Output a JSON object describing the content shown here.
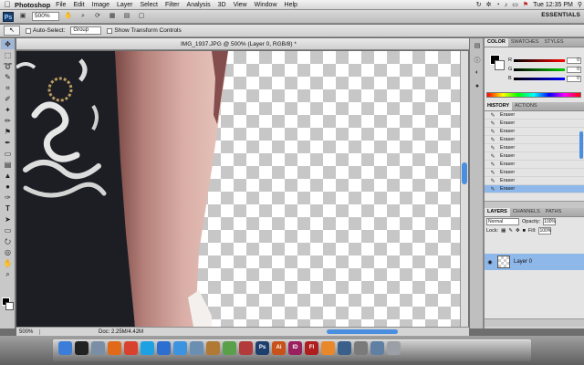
{
  "colors": {
    "accent": "#4a8ee0",
    "selection": "#8fb8ea",
    "ps_brand": "#1c3f6e"
  },
  "menubar": {
    "apple_icon": "apple-icon",
    "app_name": "Photoshop",
    "items": [
      "File",
      "Edit",
      "Image",
      "Layer",
      "Select",
      "Filter",
      "Analysis",
      "3D",
      "View",
      "Window",
      "Help"
    ],
    "time": "Tue 12:35 PM"
  },
  "appbar": {
    "logo": "Ps",
    "zoom": "500%",
    "workspace": "ESSENTIALS"
  },
  "options": {
    "auto_select": "Auto-Select:",
    "auto_select_target": "Group",
    "transform_controls": "Show Transform Controls"
  },
  "document": {
    "tab_title": "IMG_1937.JPG @ 500% (Layer 0, RGB/8) *",
    "status_zoom": "500%",
    "status_info": "Doc: 2.25M/4.42M"
  },
  "color_panel": {
    "tabs": [
      "COLOR",
      "SWATCHES",
      "STYLES"
    ],
    "r": "0",
    "g": "0",
    "b": "0"
  },
  "history_panel": {
    "tabs": [
      "HISTORY",
      "ACTIONS"
    ],
    "items": [
      "Eraser",
      "Eraser",
      "Eraser",
      "Eraser",
      "Eraser",
      "Eraser",
      "Eraser",
      "Eraser",
      "Eraser",
      "Eraser"
    ]
  },
  "layers_panel": {
    "tabs": [
      "LAYERS",
      "CHANNELS",
      "PATHS"
    ],
    "blend_mode": "Normal",
    "opacity_label": "Opacity:",
    "opacity": "100%",
    "lock_label": "Lock:",
    "fill_label": "Fill:",
    "fill": "100%",
    "layer_name": "Layer 0"
  },
  "dock": {
    "apps": [
      {
        "name": "finder-icon",
        "label": "",
        "color": "#3b7dd8"
      },
      {
        "name": "dashboard-icon",
        "label": "",
        "color": "#222"
      },
      {
        "name": "mail-icon",
        "label": "",
        "color": "#7a8ea6"
      },
      {
        "name": "firefox-icon",
        "label": "",
        "color": "#e06a1a"
      },
      {
        "name": "chrome-icon",
        "label": "",
        "color": "#d9412f"
      },
      {
        "name": "skype-icon",
        "label": "",
        "color": "#1da1e2"
      },
      {
        "name": "itunes-icon",
        "label": "",
        "color": "#2d6fd1"
      },
      {
        "name": "safari-icon",
        "label": "",
        "color": "#3c93e0"
      },
      {
        "name": "preview-icon",
        "label": "",
        "color": "#6b8fb3"
      },
      {
        "name": "tools-icon",
        "label": "",
        "color": "#b07a34"
      },
      {
        "name": "facetime-icon",
        "label": "",
        "color": "#5aa04a"
      },
      {
        "name": "photobooth-icon",
        "label": "",
        "color": "#b33a3a"
      },
      {
        "name": "photoshop-icon",
        "label": "Ps",
        "color": "#1c3f6e"
      },
      {
        "name": "illustrator-icon",
        "label": "Ai",
        "color": "#c8521a"
      },
      {
        "name": "indesign-icon",
        "label": "ID",
        "color": "#9a1f5e"
      },
      {
        "name": "flash-icon",
        "label": "Fl",
        "color": "#b01d1d"
      },
      {
        "name": "vlc-icon",
        "label": "",
        "color": "#e9882a"
      },
      {
        "name": "quicktime-icon",
        "label": "",
        "color": "#3a5f8a"
      },
      {
        "name": "settings-icon",
        "label": "",
        "color": "#7a7a7a"
      },
      {
        "name": "downloads-icon",
        "label": "",
        "color": "#5f7fa3"
      },
      {
        "name": "trash-icon",
        "label": "",
        "color": "#9aa0a6"
      }
    ]
  }
}
